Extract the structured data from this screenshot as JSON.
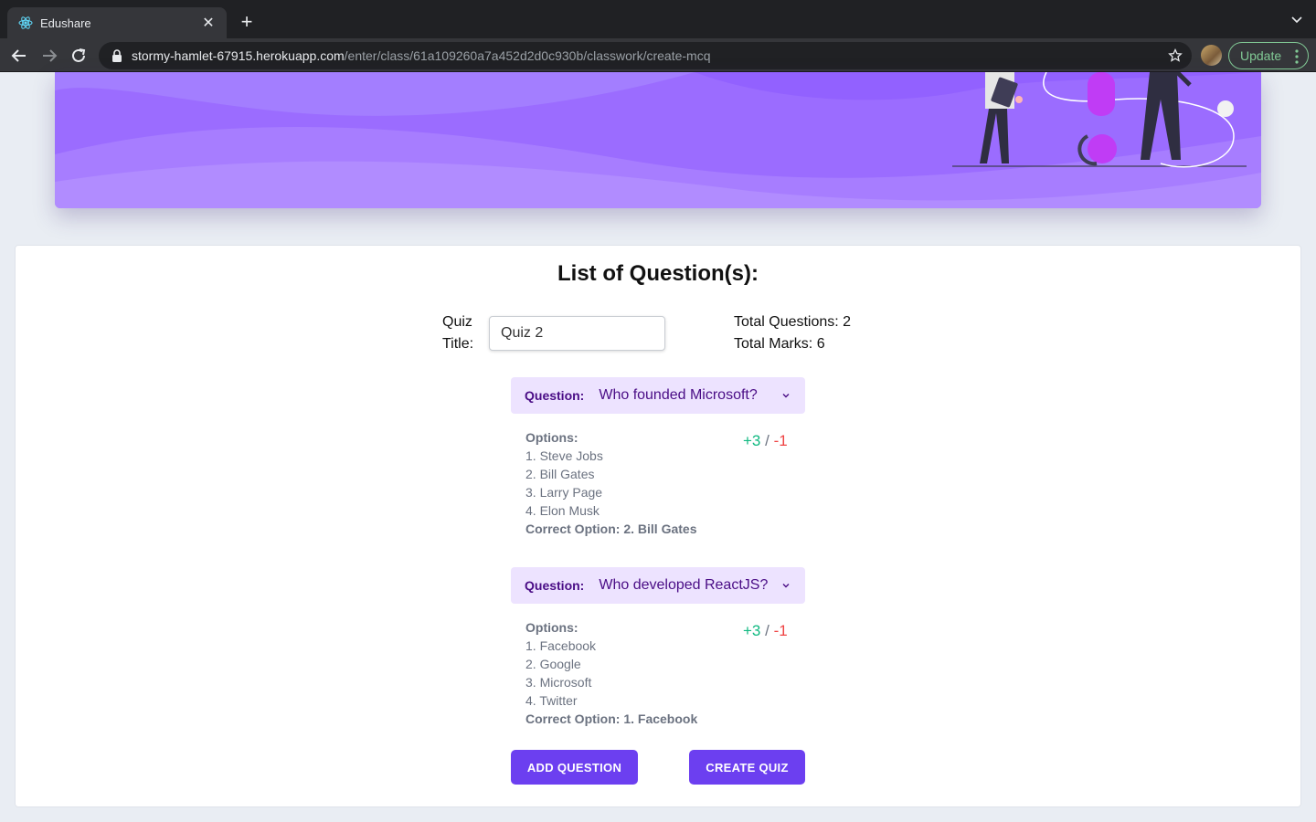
{
  "browser": {
    "tab_title": "Edushare",
    "url_host": "stormy-hamlet-67915.herokuapp.com",
    "url_path": "/enter/class/61a109260a7a452d2d0c930b/classwork/create-mcq",
    "update_label": "Update"
  },
  "page": {
    "title": "List of Question(s):",
    "quiz_title_label": "Quiz Title:",
    "quiz_title_value": "Quiz 2",
    "total_questions": "Total Questions: 2",
    "total_marks": "Total Marks: 6"
  },
  "questions": [
    {
      "label": "Question:",
      "text": "Who founded Microsoft?",
      "options_heading": "Options:",
      "options": [
        "1. Steve Jobs",
        "2. Bill Gates",
        "3. Larry Page",
        "4. Elon Musk"
      ],
      "correct": "Correct Option: 2. Bill Gates",
      "plus": "+3",
      "slash": "/",
      "minus": "-1"
    },
    {
      "label": "Question:",
      "text": "Who developed ReactJS?",
      "options_heading": "Options:",
      "options": [
        "1. Facebook",
        "2. Google",
        "3. Microsoft",
        "4. Twitter"
      ],
      "correct": "Correct Option: 1. Facebook",
      "plus": "+3",
      "slash": "/",
      "minus": "-1"
    }
  ],
  "actions": {
    "add_question": "ADD QUESTION",
    "create_quiz": "CREATE QUIZ"
  },
  "colors": {
    "primary": "#6c3ff0",
    "question_bg": "#ede3ff",
    "question_text": "#4a0d86",
    "positive": "#10b981",
    "negative": "#ef4444"
  }
}
